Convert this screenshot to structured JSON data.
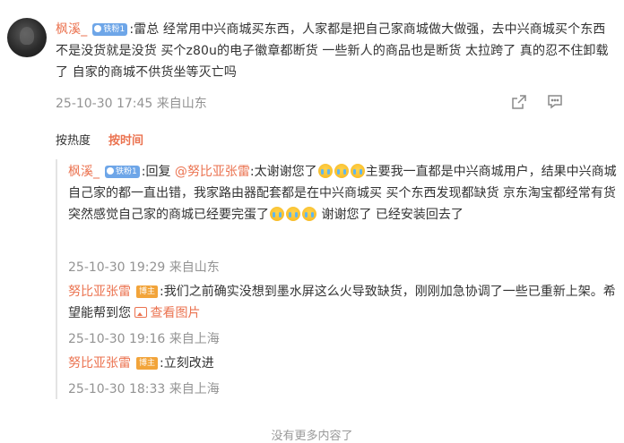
{
  "main_comment": {
    "username": "枫溪_",
    "badge": "铁粉1",
    "text": ":雷总 经常用中兴商城买东西，人家都是把自己家商城做大做强，去中兴商城买个东西 不是没货就是没货 买个z80u的电子徽章都断货 一些新人的商品也是断货 太拉跨了 真的忍不住卸载了 自家的商城不供货坐等灭亡吗",
    "time": "25-10-30 17:45",
    "location": "来自山东",
    "share_icon": "share-icon",
    "comment_icon": "comment-icon"
  },
  "sort_bar": {
    "hot_label": "按热度",
    "time_label": "按时间",
    "active": "time"
  },
  "replies": [
    {
      "username": "枫溪_",
      "badge": "铁粉1",
      "prefix": ":回复",
      "mention": "@努比亚张雷",
      "text_part1": ":太谢谢您了",
      "text_part2": "主要我一直都是中兴商城用户，结果中兴商城自己家的都一直出错，我家路由器配套都是在中兴商城买 买个东西发现都缺货 京东淘宝都经常有货 突然感觉自己家的商城已经要完蛋了",
      "text_part3": " 谢谢您了 已经安装回去了",
      "emoji_name": "crying-emoji",
      "time": "25-10-30 19:29",
      "location": "来自山东"
    },
    {
      "username": "努比亚张雷",
      "badge": "博主",
      "text": ":我们之前确实没想到墨水屏这么火导致缺货，刚刚加急协调了一些已重新上架。希望能帮到您",
      "link_text": "查看图片",
      "time": "25-10-30 19:16",
      "location": "来自上海"
    },
    {
      "username": "努比亚张雷",
      "badge": "博主",
      "text": ":立刻改进",
      "time": "25-10-30 18:33",
      "location": "来自上海"
    }
  ],
  "footer": {
    "no_more": "没有更多内容了"
  },
  "colors": {
    "accent": "#eb7350",
    "badge_fan": "#6ea6e8",
    "badge_blogger": "#f2a43a",
    "meta": "#939393"
  }
}
